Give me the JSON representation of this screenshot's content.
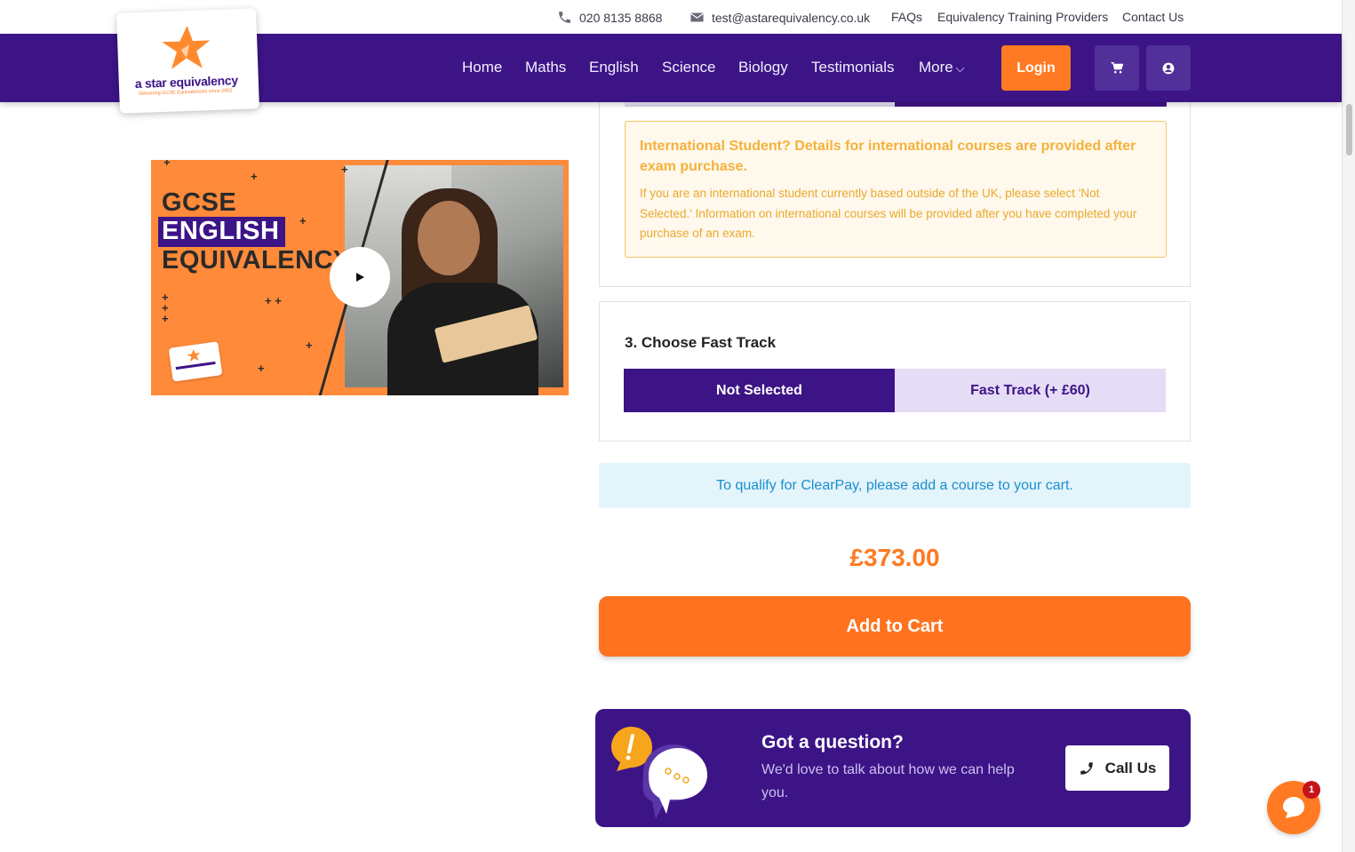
{
  "topbar": {
    "phone": "020 8135 8868",
    "email": "test@astarequivalency.co.uk",
    "links": [
      "FAQs",
      "Equivalency Training Providers",
      "Contact Us"
    ]
  },
  "logo": {
    "name": "a star equivalency",
    "tagline": "Delivering GCSE Equivalencies since 2002"
  },
  "nav": {
    "items": [
      "Home",
      "Maths",
      "English",
      "Science",
      "Biology",
      "Testimonials",
      "More"
    ],
    "login_label": "Login",
    "icons": [
      "cart-icon",
      "user-icon"
    ]
  },
  "video": {
    "line1": "GCSE",
    "line2": "ENGLISH",
    "line3": "EQUIVALENCY",
    "play_icon": "play-icon"
  },
  "notice": {
    "title": "International Student? Details for international courses are provided after exam purchase.",
    "body": "If you are an international student currently based outside of the UK, please select 'Not Selected.' Information on international courses will be provided after you have completed your purchase of an exam."
  },
  "fast_track": {
    "title": "3. Choose Fast Track",
    "options": [
      "Not Selected",
      "Fast Track (+ £60)"
    ],
    "selected": "Not Selected"
  },
  "clearpay_text": "To qualify for ClearPay, please add a course to your cart.",
  "price": "£373.00",
  "add_to_cart_label": "Add to Cart",
  "question": {
    "title": "Got a question?",
    "body": "We'd love to talk about how we can help you.",
    "call_label": "Call Us"
  },
  "chat": {
    "badge_count": "1"
  },
  "colors": {
    "brand_purple": "#3c1486",
    "brand_orange": "#ff7a22",
    "notice_text": "#e9a92c",
    "clearpay_text": "#1a8fcf"
  }
}
